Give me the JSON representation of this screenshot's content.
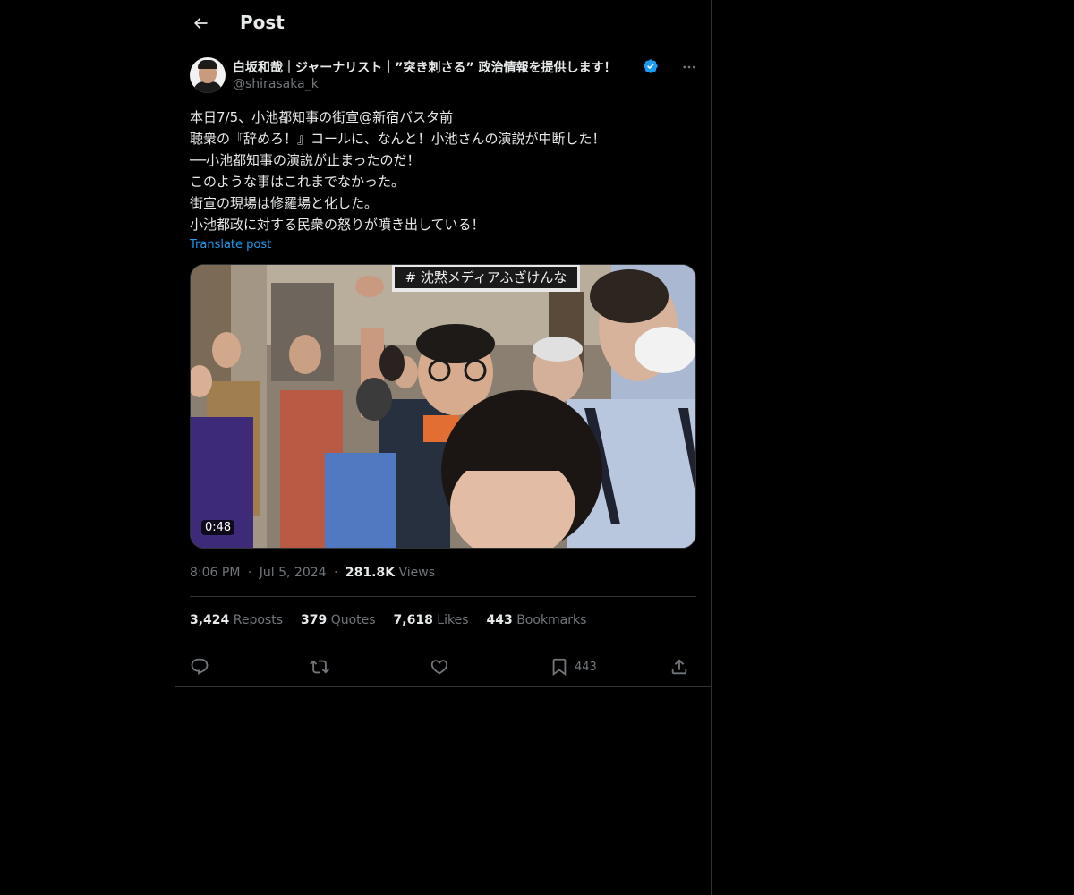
{
  "header": {
    "title": "Post",
    "back_icon": "arrow-left-icon"
  },
  "author": {
    "name": "白坂和哉｜ジャーナリスト｜”突き刺さる” 政治情報を提供します！",
    "handle": "@shirasaka_k",
    "verified_color": "#1d9bf0"
  },
  "post": {
    "lines": [
      "本日7/5、小池都知事の街宣@新宿バスタ前",
      "聴衆の『辞めろ！』コールに、なんと！小池さんの演説が中断した！",
      "──小池都知事の演説が止まったのだ！",
      "このような事はこれまでなかった。",
      "街宣の現場は修羅場と化した。",
      "小池都政に対する民衆の怒りが噴き出している！"
    ],
    "translate_label": "Translate post"
  },
  "media": {
    "sign_text": "# 沈黙メディアふざけんな",
    "duration": "0:48"
  },
  "meta": {
    "time": "8:06 PM",
    "date": "Jul 5, 2024",
    "views_count": "281.8K",
    "views_label": "Views",
    "separator": "·"
  },
  "stats": {
    "reposts": {
      "count": "3,424",
      "label": "Reposts"
    },
    "quotes": {
      "count": "379",
      "label": "Quotes"
    },
    "likes": {
      "count": "7,618",
      "label": "Likes"
    },
    "bookmarks": {
      "count": "443",
      "label": "Bookmarks"
    }
  },
  "actions": {
    "bookmark_count": "443"
  },
  "colors": {
    "background": "#000000",
    "border": "#2f3336",
    "text_primary": "#e7e9ea",
    "text_secondary": "#71767b",
    "accent": "#1d9bf0"
  }
}
